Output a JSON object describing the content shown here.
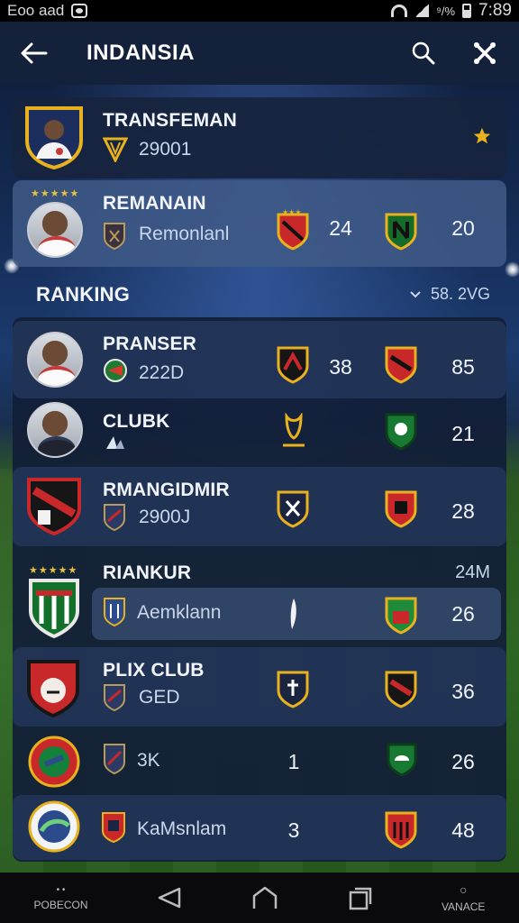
{
  "status_bar": {
    "left_text": "Eoo aad",
    "battery_text": "⁹/%",
    "time": "7:89"
  },
  "app_bar": {
    "title": "INDANSIA"
  },
  "top_card": {
    "name": "TRANSFEMAN",
    "value": "29001"
  },
  "highlight_card": {
    "name": "REMANAIN",
    "sub": "Remonlanl",
    "value_a": "24",
    "value_b": "20"
  },
  "ranking": {
    "title": "RANKING",
    "filter": "58. 2VG"
  },
  "rows": [
    {
      "name": "PRANSER",
      "sub": "222D",
      "value_a": "38",
      "value_b": "85"
    },
    {
      "name": "CLUBK",
      "sub": "",
      "value_a": "",
      "value_b": "21"
    },
    {
      "name": "RMANGIDMIR",
      "sub": "2900J",
      "value_a": "",
      "value_b": "28"
    },
    {
      "name": "RIANKUR",
      "sub": "Aemklann",
      "value_a": "",
      "value_b": "26",
      "extra": "24M"
    },
    {
      "name": "PLIX CLUB",
      "sub": "GED",
      "value_a": "",
      "value_b": "36"
    },
    {
      "name": "",
      "sub": "3K",
      "value_a": "1",
      "value_b": "26"
    },
    {
      "name": "",
      "sub": "KaMsnlam",
      "value_a": "3",
      "value_b": "48"
    }
  ],
  "nav": {
    "left_label": "POBECON",
    "right_label": "VANACE"
  },
  "colors": {
    "accent_gold": "#e8b21f",
    "card_dark": "#16243e",
    "highlight": "#405a87"
  },
  "icons": [
    "back-arrow-icon",
    "search-icon",
    "close-icon",
    "star-icon",
    "chevron-down-icon",
    "nav-back-icon",
    "nav-home-icon",
    "nav-recents-icon"
  ]
}
